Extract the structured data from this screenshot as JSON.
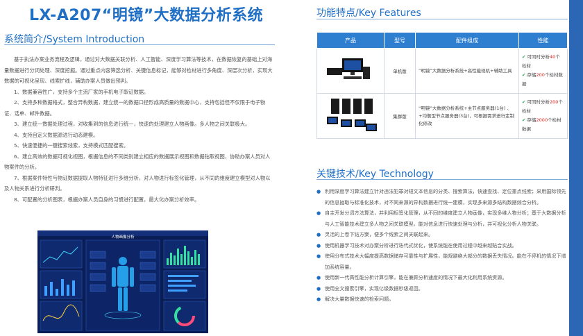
{
  "main_title": "LX-A207“明镜”大数据分析系统",
  "intro": {
    "title": "系统简介/System Introduction",
    "paragraphs": [
      "基于执法办案业务流程及逻辑，通过对大数据关联分析、人工智能、深度学习算法等技术，在数据恢复的基础上对海量数据进行分词处理、深度挖掘。通过重点内容筛选分析、关键信息标记，能够对检材进行多角度、深层次分析，实现大数据的可视化呈现、线索扩线，辅助办案人员做出预判。",
      "1、数据兼容性广，支持多个主流厂家的手机电子取证数据。",
      "2、支持多种数据格式，整合异构数据，建立统一的数据口径形成高质量的数据中心，支持包括但不仅限于电子物证、话单、邮件数据。",
      "3、建立统一数据处理过程，对收集到的信息进行统一，快速的处理建立人物画像。多人物之间关联极大。",
      "4、支持自定义数据源进行动态建模。",
      "5、快速便捷的一键搜索线索，支持模式匹配搜索。",
      "6、建立高效的数据可视化视图，根据信息的不同类别建立相应的数据展示视图和数据钻取视图，协助办案人员对人物案件的分析。",
      "7、根据案件特性与物证数据提取人物特征进行多维分析，对人物进行标签化管理，从不同的维度建立模型对人物以及人物关系进行分析研判。",
      "8、可配置的分析图表，根据办案人员自身的习惯进行配置，最大化办案分析效率。"
    ]
  },
  "screenshot": {
    "title": "人物画像分析"
  },
  "features": {
    "title": "功能特点/Key Features",
    "headers": [
      "产品",
      "型号",
      "配件组成",
      "性能"
    ],
    "rows": [
      {
        "model": "单机版",
        "config": "“明镜”大数据分析系统+高性能现机+辅助工具",
        "perf": [
          {
            "pre": "可同时分析",
            "num": "40",
            "post": "个检材"
          },
          {
            "pre": "存储",
            "num": "200",
            "post": "个检材数据"
          }
        ]
      },
      {
        "model": "集群版",
        "config": "“明镜”大数据分析系统+主节点服务器(1台) 、+均衡型节点服务器(3台)，可根据需求进行定制化修改",
        "perf": [
          {
            "pre": "可同时分析",
            "num": "200",
            "post": "个检材"
          },
          {
            "pre": "存储",
            "num": "2000",
            "post": "个检材数据"
          }
        ]
      }
    ]
  },
  "key_tech": {
    "title": "关键技术/Key Technology",
    "items": [
      "利用深度学习算法建立针对违法犯罪对短文本信息的分类、搜索算法，快速查找、定位重点线索；采用国际领先的信息抽取与标准化技术，对不同来源的异构数据进行统一建模，实现多来源多结构数据综合分析。",
      "自主开发分词方法算法，并利用标签化管理，从不同的维度建立人物画像，实现多维人物分析；基于大数据分析与人工智能技术建立多人物之间关联模型。能对信息进行快速处理与分析，并可视化分析人物关联。",
      "灵活的上卷下钻方案，便多个线索之间关联起来。",
      "使用机器学习技术对办案分析进行迭代式优化，使系统能在使用过程中越来越贴合实战。",
      "使用分布式技术大幅度提高数据储存可靠性与扩展性，能规避绝大部分的数据丢失情况。能在不停机的情况下增加系统容量。",
      "使用新一代高性能分析计算引擎，能在兼顾分析速度的情况下最大化利用系统资源。",
      "使用全文搜索引擎，实现亿级数据秒级返回。",
      "解决大量数据快速的检索问题。"
    ]
  },
  "colors": {
    "accent": "#1f6fc5",
    "table_header": "#2f7fd0",
    "highlight": "#e2231a",
    "side_band": "#2b67b5"
  }
}
